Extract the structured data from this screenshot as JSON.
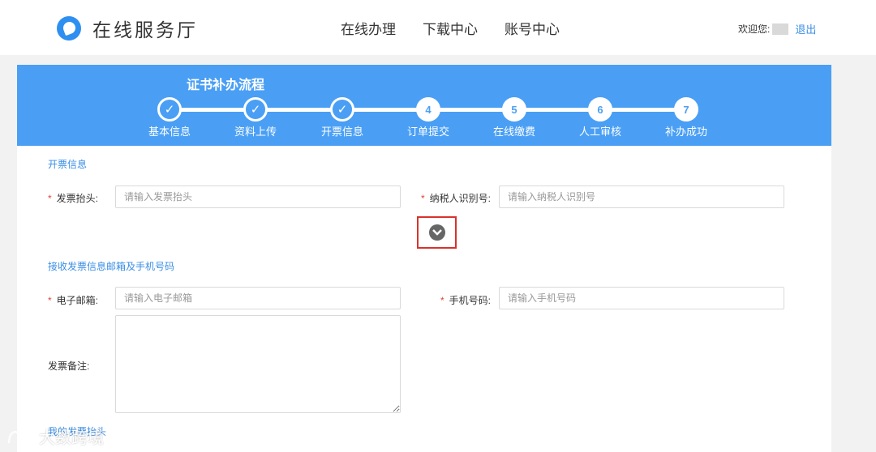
{
  "header": {
    "logo_text": "在线服务厅",
    "nav": [
      "在线办理",
      "下载中心",
      "账号中心"
    ],
    "welcome": "欢迎您:",
    "logout": "退出"
  },
  "process": {
    "title": "证书补办流程",
    "steps": [
      {
        "label": "基本信息",
        "mark": "✓",
        "done": true
      },
      {
        "label": "资料上传",
        "mark": "✓",
        "done": true
      },
      {
        "label": "开票信息",
        "mark": "✓",
        "done": true
      },
      {
        "label": "订单提交",
        "mark": "4",
        "done": false
      },
      {
        "label": "在线缴费",
        "mark": "5",
        "done": false
      },
      {
        "label": "人工审核",
        "mark": "6",
        "done": false
      },
      {
        "label": "补办成功",
        "mark": "7",
        "done": false
      }
    ]
  },
  "invoice": {
    "section_title": "开票信息",
    "title_label": "发票抬头:",
    "title_placeholder": "请输入发票抬头",
    "tax_label": "纳税人识别号:",
    "tax_placeholder": "请输入纳税人识别号"
  },
  "receive": {
    "section_title": "接收发票信息邮箱及手机号码",
    "email_label": "电子邮箱:",
    "email_placeholder": "请输入电子邮箱",
    "phone_label": "手机号码:",
    "phone_placeholder": "请输入手机号码",
    "note_label": "发票备注:"
  },
  "bottom_section_title": "我的发票抬头",
  "watermark_text": "大数跨境",
  "colors": {
    "accent": "#4a9ff5",
    "link": "#3a8ee6",
    "required": "#e0443c",
    "highlight_border": "#d9322b"
  }
}
